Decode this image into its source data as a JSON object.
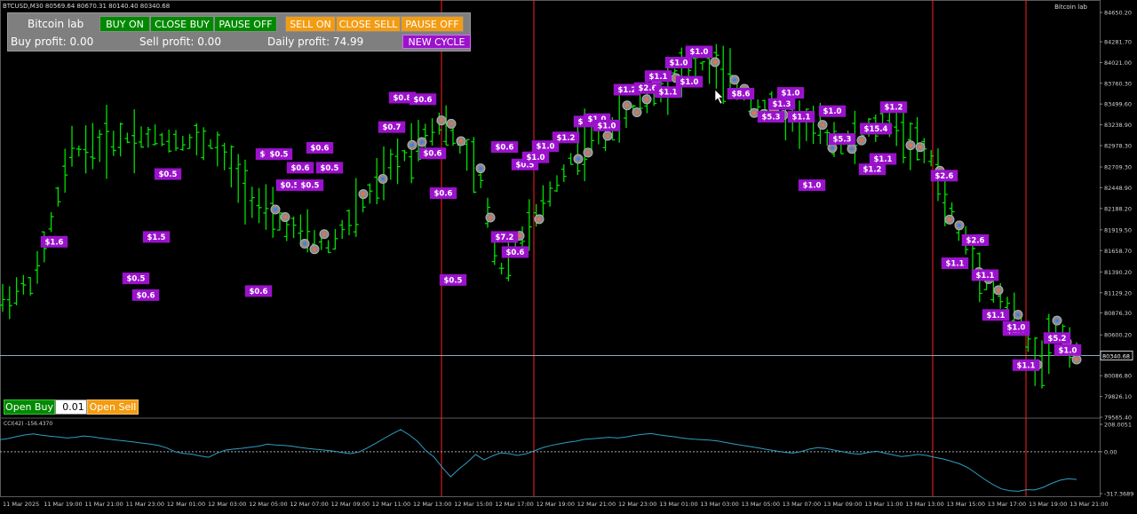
{
  "header": {
    "symbol_title": "BTCUSD,M30  80569.64 80670.31 80140.40 80340.68",
    "expert_name": "Bitcoin lab"
  },
  "panel": {
    "title": "Bitcoin lab",
    "buy_on": "BUY ON",
    "close_buy": "CLOSE BUY",
    "pause_off_buy": "PAUSE OFF",
    "sell_on": "SELL ON",
    "close_sell": "CLOSE SELL",
    "pause_off_sell": "PAUSE OFF",
    "buy_profit": "Buy profit: 0.00",
    "sell_profit": "Sell profit: 0.00",
    "daily_profit": "Daily profit: 74.99",
    "new_cycle": "NEW CYCLE"
  },
  "order_controls": {
    "open_buy": "Open Buy",
    "lot": "0.01",
    "open_sell": "Open Sell"
  },
  "price_axis": {
    "ticks": [
      "84650.20",
      "84281.70",
      "84021.00",
      "83760.30",
      "83499.60",
      "83238.90",
      "82978.30",
      "82709.30",
      "82448.90",
      "82188.20",
      "81919.50",
      "81658.70",
      "81390.20",
      "81129.20",
      "80876.30",
      "80600.20",
      "80340.68",
      "80086.80",
      "79826.10",
      "79565.40"
    ],
    "current_price": "80340.68"
  },
  "time_axis": {
    "ticks": [
      "11 Mar 2025",
      "11 Mar 19:00",
      "11 Mar 21:00",
      "11 Mar 23:00",
      "12 Mar 01:00",
      "12 Mar 03:00",
      "12 Mar 05:00",
      "12 Mar 07:00",
      "12 Mar 09:00",
      "12 Mar 11:00",
      "12 Mar 13:00",
      "12 Mar 15:00",
      "12 Mar 17:00",
      "12 Mar 19:00",
      "12 Mar 21:00",
      "12 Mar 23:00",
      "13 Mar 01:00",
      "13 Mar 03:00",
      "13 Mar 05:00",
      "13 Mar 07:00",
      "13 Mar 09:00",
      "13 Mar 11:00",
      "13 Mar 13:00",
      "13 Mar 15:00",
      "13 Mar 17:00",
      "13 Mar 19:00",
      "13 Mar 21:00"
    ]
  },
  "cci": {
    "label": "CCI(42) -156.4370",
    "axis_ticks": [
      "208.0051",
      "0.00",
      "-317.3689"
    ],
    "values": [
      92,
      100,
      115,
      128,
      135,
      125,
      118,
      112,
      104,
      110,
      120,
      114,
      104,
      96,
      88,
      82,
      74,
      66,
      58,
      48,
      28,
      0,
      -12,
      -18,
      -32,
      -42,
      -10,
      12,
      20,
      26,
      35,
      42,
      58,
      52,
      48,
      42,
      32,
      24,
      18,
      12,
      4,
      -6,
      -14,
      -2,
      28,
      64,
      100,
      136,
      168,
      130,
      80,
      10,
      -40,
      -120,
      -190,
      -130,
      -80,
      -20,
      -62,
      -32,
      -8,
      -14,
      -28,
      -16,
      6,
      30,
      48,
      60,
      72,
      80,
      94,
      98,
      104,
      110,
      104,
      112,
      124,
      132,
      138,
      128,
      120,
      112,
      102,
      96,
      92,
      88,
      82,
      70,
      58,
      48,
      38,
      28,
      16,
      6,
      -4,
      -10,
      2,
      20,
      32,
      24,
      12,
      0,
      -12,
      -18,
      -6,
      4,
      -10,
      -24,
      -36,
      -30,
      -20,
      -28,
      -42,
      -55,
      -72,
      -92,
      -122,
      -166,
      -210,
      -250,
      -282,
      -296,
      -300,
      -288,
      -290,
      -270,
      -240,
      -216,
      -205,
      -210
    ]
  },
  "profit_labels": [
    {
      "t": "$1.6",
      "p": 81770
    },
    {
      "t": "$1.5",
      "p": 81830
    },
    {
      "t": "$0.5",
      "p": 81310
    },
    {
      "t": "$0.6",
      "p": 81100
    },
    {
      "t": "$0.5",
      "p": 82620
    },
    {
      "t": "$0.6",
      "p": 81150
    },
    {
      "t": "$0.5",
      "p": 82870
    },
    {
      "t": "$0.5",
      "p": 82870
    },
    {
      "t": "$0.6",
      "p": 82700
    },
    {
      "t": "$0.5",
      "p": 82700
    },
    {
      "t": "$0.5",
      "p": 82480
    },
    {
      "t": "$0.5",
      "p": 82480
    },
    {
      "t": "$0.6",
      "p": 82950
    },
    {
      "t": "$0.7",
      "p": 83210
    },
    {
      "t": "$0.8",
      "p": 83580
    },
    {
      "t": "$0.6",
      "p": 83560
    },
    {
      "t": "$0.6",
      "p": 82880
    },
    {
      "t": "$0.6",
      "p": 82380
    },
    {
      "t": "$0.5",
      "p": 81290
    },
    {
      "t": "$0.6",
      "p": 82960
    },
    {
      "t": "$7.2",
      "p": 81830
    },
    {
      "t": "$0.6",
      "p": 81640
    },
    {
      "t": "$0.5",
      "p": 82740
    },
    {
      "t": "$1.0",
      "p": 82830
    },
    {
      "t": "$1.0",
      "p": 82970
    },
    {
      "t": "$1.2",
      "p": 83080
    },
    {
      "t": "$1.2",
      "p": 83280
    },
    {
      "t": "$1.0",
      "p": 83310
    },
    {
      "t": "$1.0",
      "p": 83230
    },
    {
      "t": "$1.2",
      "p": 83680
    },
    {
      "t": "$2.6",
      "p": 83700
    },
    {
      "t": "$1.1",
      "p": 83850
    },
    {
      "t": "$1.1",
      "p": 83650
    },
    {
      "t": "$1.0",
      "p": 83780
    },
    {
      "t": "$1.0",
      "p": 84020
    },
    {
      "t": "$1.0",
      "p": 84150
    },
    {
      "t": "$1.0",
      "p": 84160
    },
    {
      "t": "$8.6",
      "p": 83630
    },
    {
      "t": "$1.0",
      "p": 83640
    },
    {
      "t": "$1.3",
      "p": 83500
    },
    {
      "t": "$5.3",
      "p": 83340
    },
    {
      "t": "$1.1",
      "p": 83340
    },
    {
      "t": "$1.0",
      "p": 83410
    },
    {
      "t": "$5.3",
      "p": 83060
    },
    {
      "t": "$1.2",
      "p": 83460
    },
    {
      "t": "$15.4",
      "p": 83190
    },
    {
      "t": "$1.1",
      "p": 82810
    },
    {
      "t": "$1.2",
      "p": 82680
    },
    {
      "t": "$1.0",
      "p": 82480
    },
    {
      "t": "$2.6",
      "p": 82600
    },
    {
      "t": "$2.6",
      "p": 81790
    },
    {
      "t": "$1.1",
      "p": 81500
    },
    {
      "t": "$1.1",
      "p": 81350
    },
    {
      "t": "$1.1",
      "p": 80850
    },
    {
      "t": "$1.0",
      "p": 80660
    },
    {
      "t": "$1.0",
      "p": 80700
    },
    {
      "t": "$5.2",
      "p": 80560
    },
    {
      "t": "$1.0",
      "p": 80410
    },
    {
      "t": "$1.1",
      "p": 80220
    }
  ],
  "colors": {
    "background": "#000000",
    "candle": "#00e000",
    "session_separator": "#ff2020",
    "label_bg": "#9b12cc",
    "buy_green": "#008a00",
    "sell_orange": "#f39c12",
    "cci_line": "#2e9fc4",
    "axis_text": "#d0d0d0"
  }
}
